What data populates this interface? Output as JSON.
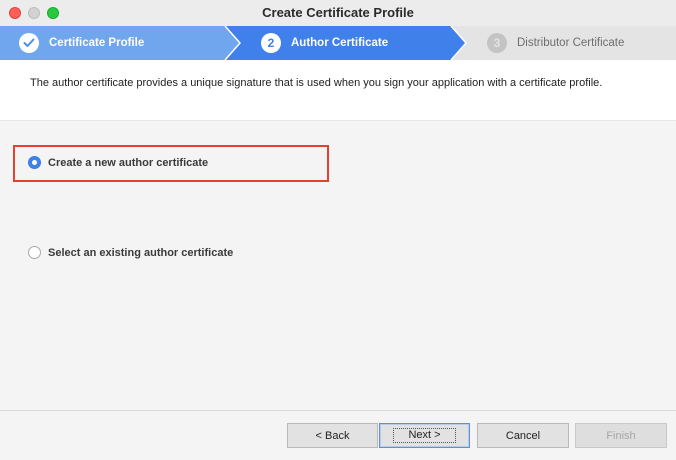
{
  "window": {
    "title": "Create Certificate Profile"
  },
  "steps": [
    {
      "number": "",
      "label": "Certificate Profile",
      "state": "completed",
      "icon": "checkmark-icon"
    },
    {
      "number": "2",
      "label": "Author Certificate",
      "state": "active"
    },
    {
      "number": "3",
      "label": "Distributor Certificate",
      "state": "pending"
    }
  ],
  "colors": {
    "step_completed": "#6fa6ee",
    "step_active": "#3f80ea",
    "step_pending": "#e4e4e4",
    "highlight_border": "#e3412d"
  },
  "description": "The author certificate provides a unique signature that is used when you sign your application with a certificate profile.",
  "options": [
    {
      "label": "Create a new author certificate",
      "selected": true
    },
    {
      "label": "Select an existing author certificate",
      "selected": false
    }
  ],
  "buttons": {
    "back": "< Back",
    "next": "Next >",
    "cancel": "Cancel",
    "finish": "Finish"
  }
}
